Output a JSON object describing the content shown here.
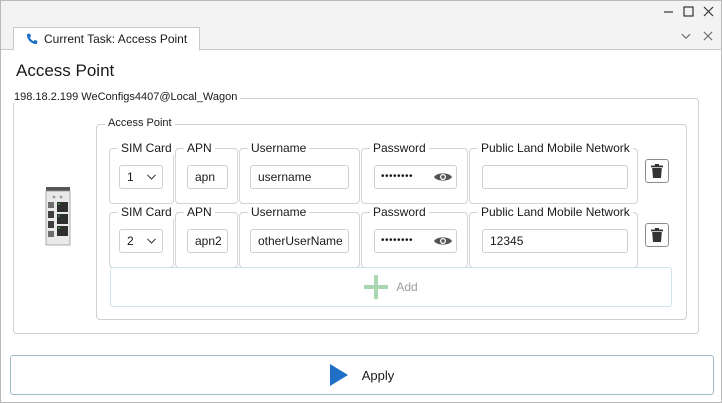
{
  "tab": {
    "title": "Current Task: Access Point"
  },
  "page": {
    "title": "Access Point"
  },
  "device": {
    "label": "198.18.2.199 WeConfigs4407@Local_Wagon"
  },
  "group": {
    "title": "Access Point"
  },
  "columns": {
    "sim_card": "SIM Card",
    "apn": "APN",
    "username": "Username",
    "password": "Password",
    "plmn": "Public Land Mobile Network"
  },
  "rows": [
    {
      "sim_card": "1",
      "apn": "apn",
      "username": "username",
      "password_mask": "••••••••",
      "plmn": ""
    },
    {
      "sim_card": "2",
      "apn": "apn2",
      "username": "otherUserName",
      "password_mask": "••••••••",
      "plmn": "12345"
    }
  ],
  "actions": {
    "add_label": "Add",
    "apply_label": "Apply"
  },
  "icons": {
    "tab": "phone-icon",
    "row_delete": "trash-icon",
    "password_toggle": "eye-icon",
    "add": "plus-icon",
    "apply": "play-icon",
    "sim_dropdown": "chevron-down-icon",
    "window_minimize": "minimize-icon",
    "window_maximize": "maximize-icon",
    "window_close": "close-icon",
    "tab_dropdown": "chevron-down-icon",
    "tab_close": "close-icon"
  },
  "colors": {
    "apply_icon": "#1f6fc6",
    "add_icon": "#a9d7b1",
    "tab_icon": "#1f6fc6"
  }
}
